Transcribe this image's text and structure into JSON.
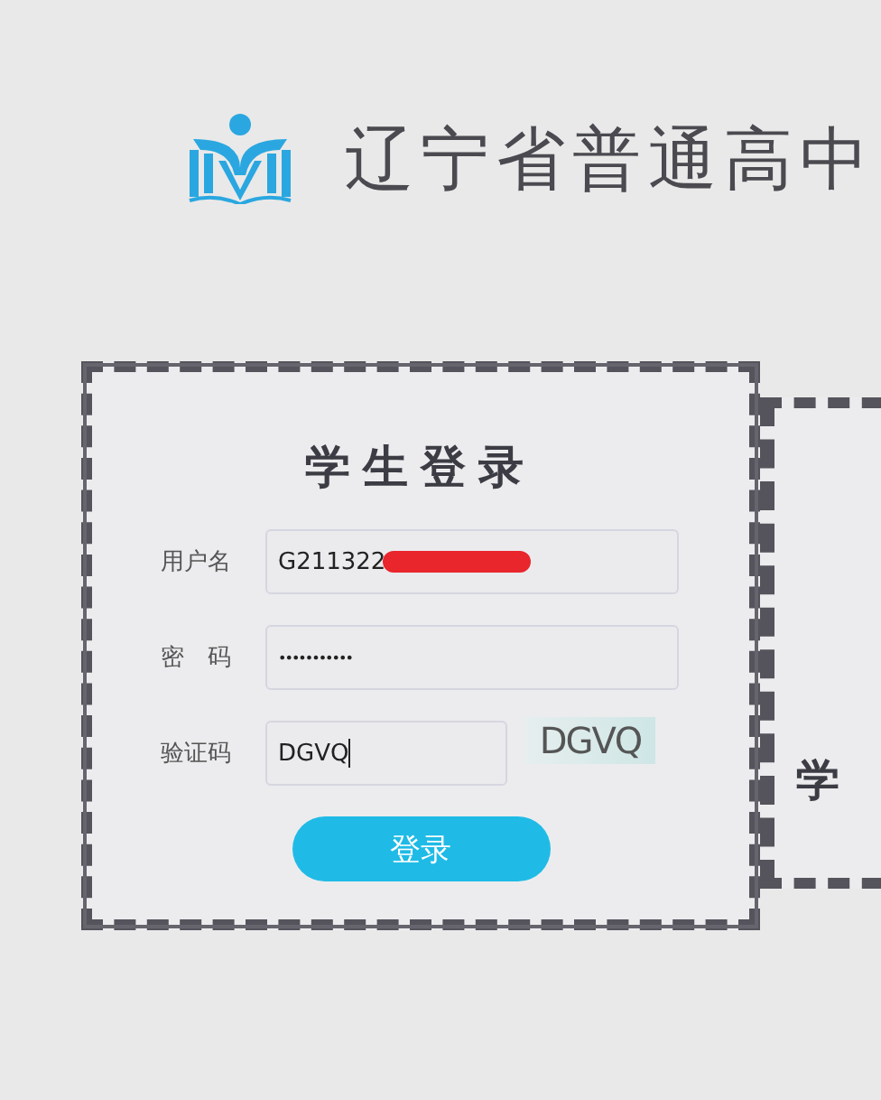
{
  "header": {
    "title": "辽宁省普通高中"
  },
  "login": {
    "title": "学生登录",
    "fields": [
      {
        "kind": "text",
        "label": "用户名",
        "value": "G211322",
        "redacted": true
      },
      {
        "kind": "password",
        "label": "密　码",
        "value": "•••••••••••",
        "redacted": false
      },
      {
        "kind": "captcha",
        "label": "验证码",
        "value": "DGVQ",
        "captcha": "DGVQ",
        "redacted": false
      }
    ],
    "button": "登录"
  },
  "side_card": {
    "title": "学"
  }
}
